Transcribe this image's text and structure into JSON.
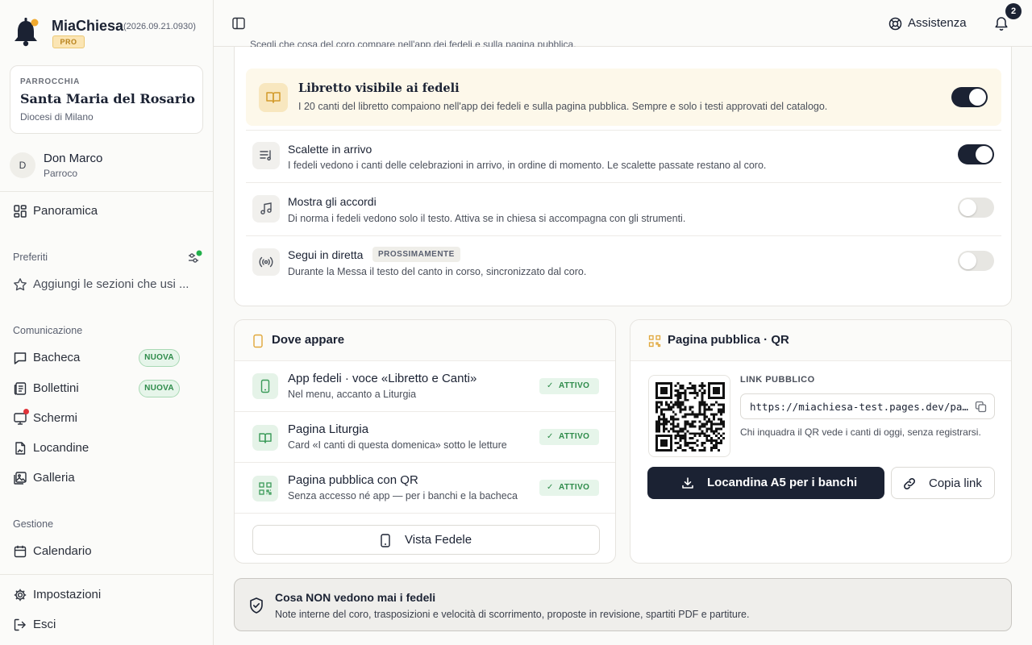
{
  "brand": {
    "name": "MiaChiesa",
    "version": "(2026.09.21.0930)",
    "plan": "PRO"
  },
  "parish": {
    "kicker": "PARROCCHIA",
    "name": "Santa Maria del Rosario",
    "diocese": "Diocesi di Milano"
  },
  "user": {
    "initial": "D",
    "name": "Don Marco",
    "role": "Parroco"
  },
  "nav": {
    "overview": "Panoramica",
    "favorites_label": "Preferiti",
    "favorites_hint": "Aggiungi le sezioni che usi ...",
    "comm_label": "Comunicazione",
    "comm_items": [
      {
        "label": "Bacheca",
        "badge": "NUOVA"
      },
      {
        "label": "Bollettini",
        "badge": "NUOVA"
      },
      {
        "label": "Schermi"
      },
      {
        "label": "Locandine"
      },
      {
        "label": "Galleria"
      }
    ],
    "mgmt_label": "Gestione",
    "calendar": "Calendario",
    "settings": "Impostazioni",
    "logout": "Esci"
  },
  "topbar": {
    "clipped_text": "Scegli che cosa del coro compare nell'app dei fedeli e sulla pagina pubblica.",
    "assist_label": "Assistenza",
    "notif_count": "2"
  },
  "visibility": {
    "rows": [
      {
        "title": "Libretto visibile ai fedeli",
        "desc": "I 20 canti del libretto compaiono nell'app dei fedeli e sulla pagina pubblica. Sempre e solo i testi approvati del catalogo.",
        "on": true
      },
      {
        "title": "Scalette in arrivo",
        "desc": "I fedeli vedono i canti delle celebrazioni in arrivo, in ordine di momento. Le scalette passate restano al coro.",
        "on": true
      },
      {
        "title": "Mostra gli accordi",
        "desc": "Di norma i fedeli vedono solo il testo. Attiva se in chiesa si accompagna con gli strumenti.",
        "on": false
      },
      {
        "title": "Segui in diretta",
        "badge": "PROSSIMAMENTE",
        "desc": "Durante la Messa il testo del canto in corso, sincronizzato dal coro.",
        "on": false
      }
    ]
  },
  "where": {
    "title": "Dove appare",
    "items": [
      {
        "title": "App fedeli · voce «Libretto e Canti»",
        "desc": "Nel menu, accanto a Liturgia",
        "status": "ATTIVO"
      },
      {
        "title": "Pagina Liturgia",
        "desc": "Card «I canti di questa domenica» sotto le letture",
        "status": "ATTIVO"
      },
      {
        "title": "Pagina pubblica con QR",
        "desc": "Senza accesso né app — per i banchi e la bacheca",
        "status": "ATTIVO"
      }
    ],
    "button": "Vista Fedele"
  },
  "public_page": {
    "title": "Pagina pubblica · QR",
    "link_label": "LINK PUBBLICO",
    "link_value": "https://miachiesa-test.pages.dev/pa…",
    "hint": "Chi inquadra il QR vede i canti di oggi, senza registrarsi.",
    "download_button": "Locandina A5 per i banchi",
    "copy_button": "Copia link"
  },
  "notice": {
    "title": "Cosa NON vedono mai i fedeli",
    "desc": "Note interne del coro, trasposizioni e velocità di scorrimento, proposte in revisione, spartiti PDF e partiture."
  },
  "colors": {
    "dark": "#1b2233",
    "green": "#2e8b4a",
    "amber_bg": "#fdf8ea",
    "red": "#e0343a"
  }
}
